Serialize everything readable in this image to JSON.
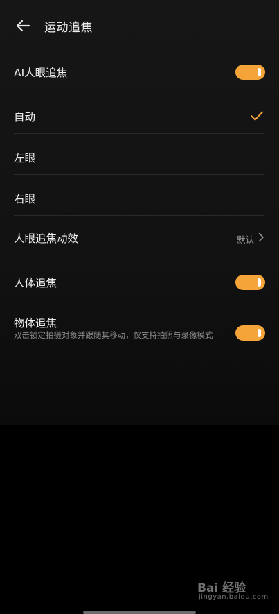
{
  "header": {
    "title": "运动追焦"
  },
  "ai_eye": {
    "label": "AI人眼追焦",
    "enabled": true
  },
  "eye_options": [
    {
      "label": "自动",
      "selected": true
    },
    {
      "label": "左眼",
      "selected": false
    },
    {
      "label": "右眼",
      "selected": false
    }
  ],
  "eye_effect": {
    "label": "人眼追焦动效",
    "value": "默认"
  },
  "body_tracking": {
    "label": "人体追焦",
    "enabled": true
  },
  "object_tracking": {
    "label": "物体追焦",
    "description": "双击锁定拍摄对象并跟随其移动，仅支持拍照与录像模式",
    "enabled": true
  },
  "watermark": {
    "logo": "Bai 经验",
    "url": "jingyan.baidu.com"
  },
  "colors": {
    "accent": "#f5a43a",
    "background": "#121212"
  },
  "icons": [
    "back-arrow-icon",
    "check-icon",
    "chevron-right-icon"
  ]
}
